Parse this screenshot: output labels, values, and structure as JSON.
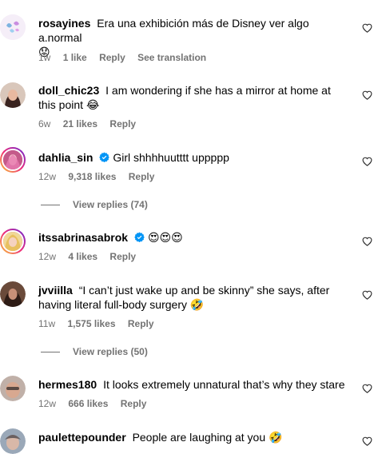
{
  "comments": [
    {
      "username": "rosayines",
      "text": "Era una exhibición más de Disney ver algo a.normal",
      "emoji": "😟",
      "time": "1w",
      "likes": "1 like",
      "reply": "Reply",
      "translate": "See translation",
      "verified": false,
      "avatar_color": "#e8d8f0"
    },
    {
      "username": "doll_chic23",
      "text": "I am wondering if she has a mirror at home at this point",
      "emoji": "😂",
      "time": "6w",
      "likes": "21 likes",
      "reply": "Reply",
      "verified": false,
      "avatar_color": "#3a2a22"
    },
    {
      "username": "dahlia_sin",
      "text": "Girl shhhhuutttt uppppp",
      "emoji": "",
      "time": "12w",
      "likes": "9,318 likes",
      "reply": "Reply",
      "verified": true,
      "avatar_color": "#b04a7a",
      "replies": "View replies (74)"
    },
    {
      "username": "itssabrinasabrok",
      "text": "",
      "emoji": "😍😍😍",
      "time": "12w",
      "likes": "4 likes",
      "reply": "Reply",
      "verified": true,
      "avatar_color": "#e8c070"
    },
    {
      "username": "jvviilla",
      "text": "“I can’t just wake up and be skinny” she says, after having literal full-body surgery",
      "emoji": "🤣",
      "time": "11w",
      "likes": "1,575 likes",
      "reply": "Reply",
      "verified": false,
      "avatar_color": "#4a3228",
      "replies": "View replies (50)"
    },
    {
      "username": "hermes180",
      "text": "It looks extremely unnatural that’s why they stare",
      "emoji": "",
      "time": "12w",
      "likes": "666 likes",
      "reply": "Reply",
      "verified": false,
      "avatar_color": "#a08878"
    },
    {
      "username": "paulettepounder",
      "text": "People are laughing at you",
      "emoji": "🤣",
      "time": "",
      "likes": "",
      "reply": "",
      "verified": false,
      "avatar_color": "#7a8aa0"
    }
  ],
  "colors": {
    "meta": "#737373",
    "verified": "#0095f6"
  }
}
